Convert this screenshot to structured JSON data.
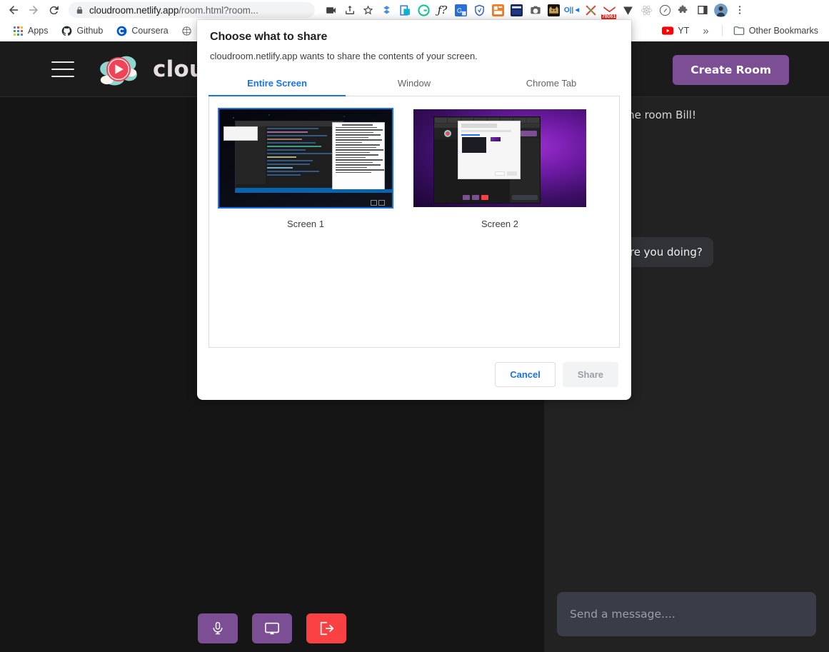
{
  "browser": {
    "nav": {
      "back_icon": "arrow-left-icon",
      "forward_icon": "arrow-right-icon",
      "reload_icon": "reload-icon"
    },
    "omnibox": {
      "lock_icon": "lock-icon",
      "url_main": "cloudroom.netlify.app",
      "url_path": "/room.html?room..."
    },
    "toolbar_icons": [
      {
        "name": "camera-record-icon",
        "color": "#3c4043"
      },
      {
        "name": "share-upload-icon",
        "color": "#3c4043"
      },
      {
        "name": "bookmark-star-icon",
        "color": "#3c4043"
      },
      {
        "name": "extension-dropbox-icon",
        "color": "#4a90e2"
      },
      {
        "name": "extension-pagecopy-icon",
        "color": "#00b8d4"
      },
      {
        "name": "extension-grammarly-icon",
        "color": "#15c39a"
      },
      {
        "name": "extension-mathfont-icon",
        "color": "#202124"
      },
      {
        "name": "extension-google-translate-icon",
        "color": "#2a6fd6"
      },
      {
        "name": "extension-shield-zenmate-icon",
        "color": "#2d5fd0"
      },
      {
        "name": "extension-orange-notes-icon",
        "color": "#f57c1f"
      },
      {
        "name": "extension-oxford-dictionary-icon",
        "color": "#12275e"
      },
      {
        "name": "extension-screenshot-camera-icon",
        "color": "#5f6368"
      },
      {
        "name": "extension-dark-cat-icon",
        "color": "#c9a24d"
      },
      {
        "name": "extension-onetab-icon",
        "color": "#1a73e8"
      },
      {
        "name": "extension-scissors-icon",
        "color": "#e04c3d"
      },
      {
        "name": "extension-gmail-icon",
        "color": "#d93025",
        "badge": "78061"
      },
      {
        "name": "extension-vimeo-v-icon",
        "color": "#3c4043"
      },
      {
        "name": "extension-react-icon",
        "color": "#bdc1c6"
      },
      {
        "name": "extension-clock-icon",
        "color": "#5f6368"
      },
      {
        "name": "extensions-puzzle-icon",
        "color": "#5f6368"
      },
      {
        "name": "extension-sidepanel-icon",
        "color": "#3c4043"
      },
      {
        "name": "profile-avatar-icon",
        "color": "#6d9ecb"
      },
      {
        "name": "chrome-menu-icon",
        "color": "#5f6368"
      }
    ],
    "bookmarks": [
      {
        "label": "Apps",
        "icon": "apps-grid-icon"
      },
      {
        "label": "Github",
        "icon": "github-icon"
      },
      {
        "label": "Coursera",
        "icon": "coursera-icon"
      },
      {
        "label": "",
        "icon": "brain-icon"
      },
      {
        "label": "YT",
        "icon": "youtube-icon"
      }
    ],
    "overflow_label": "»",
    "other_bookmarks": {
      "label": "Other Bookmarks",
      "icon": "folder-icon"
    }
  },
  "app": {
    "menu_icon": "hamburger-menu-icon",
    "logo_icon": "cloudroom-logo-icon",
    "brand": "cloudRoom",
    "create_room_label": "Create Room",
    "create_room_color": "#7c4f94",
    "chat": {
      "messages": [
        {
          "text": "Welcome to the room Bill!",
          "type": "system"
        },
        {
          "text": "Hey! How are you doing?",
          "type": "bubble"
        }
      ],
      "input_placeholder": "Send a message...."
    },
    "controls": [
      {
        "name": "microphone-button",
        "icon": "microphone-icon",
        "color": "#7c4f94"
      },
      {
        "name": "share-screen-button",
        "icon": "monitor-icon",
        "color": "#7c4f94"
      },
      {
        "name": "leave-room-button",
        "icon": "exit-icon",
        "color": "#f94144"
      }
    ]
  },
  "dialog": {
    "title": "Choose what to share",
    "subtitle": "cloudroom.netlify.app wants to share the contents of your screen.",
    "tabs": [
      {
        "label": "Entire Screen",
        "active": true
      },
      {
        "label": "Window",
        "active": false
      },
      {
        "label": "Chrome Tab",
        "active": false
      }
    ],
    "accent_color": "#1a73e8",
    "sources": [
      {
        "label": "Screen 1",
        "selected": true
      },
      {
        "label": "Screen 2",
        "selected": false
      }
    ],
    "cancel_label": "Cancel",
    "share_label": "Share"
  }
}
